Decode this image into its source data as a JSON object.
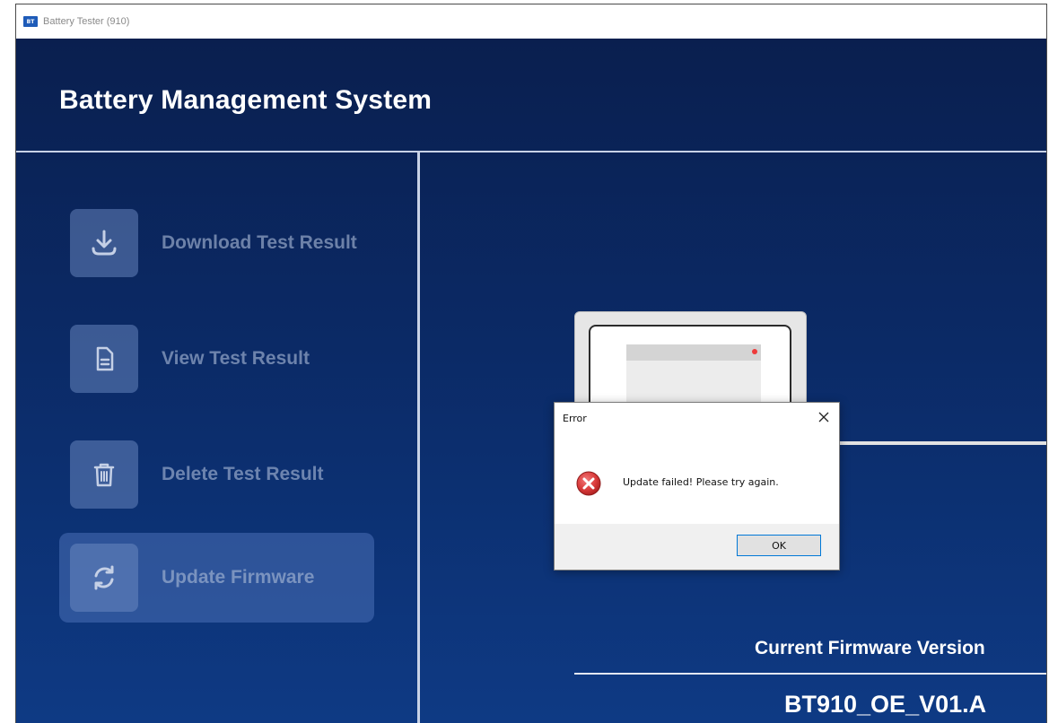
{
  "window": {
    "icon_text": "BT",
    "title": "Battery Tester (910)"
  },
  "header": {
    "app_title": "Battery Management System"
  },
  "sidebar": {
    "items": [
      {
        "label": "Download Test Result",
        "icon": "download-icon",
        "active": false
      },
      {
        "label": "View Test Result",
        "icon": "document-icon",
        "active": false
      },
      {
        "label": "Delete Test Result",
        "icon": "trash-icon",
        "active": false
      },
      {
        "label": "Update Firmware",
        "icon": "refresh-icon",
        "active": true
      }
    ]
  },
  "main": {
    "illustration": "laptop-illustration",
    "firmware_label": "Current Firmware Version",
    "firmware_version": "BT910_OE_V01.A"
  },
  "dialog": {
    "title": "Error",
    "message": "Update failed! Please try again.",
    "ok_label": "OK",
    "icon": "error-icon"
  },
  "colors": {
    "app_background": "#0b2a66",
    "accent_error": "#d93a3a",
    "dialog_button_border": "#0078d7"
  }
}
